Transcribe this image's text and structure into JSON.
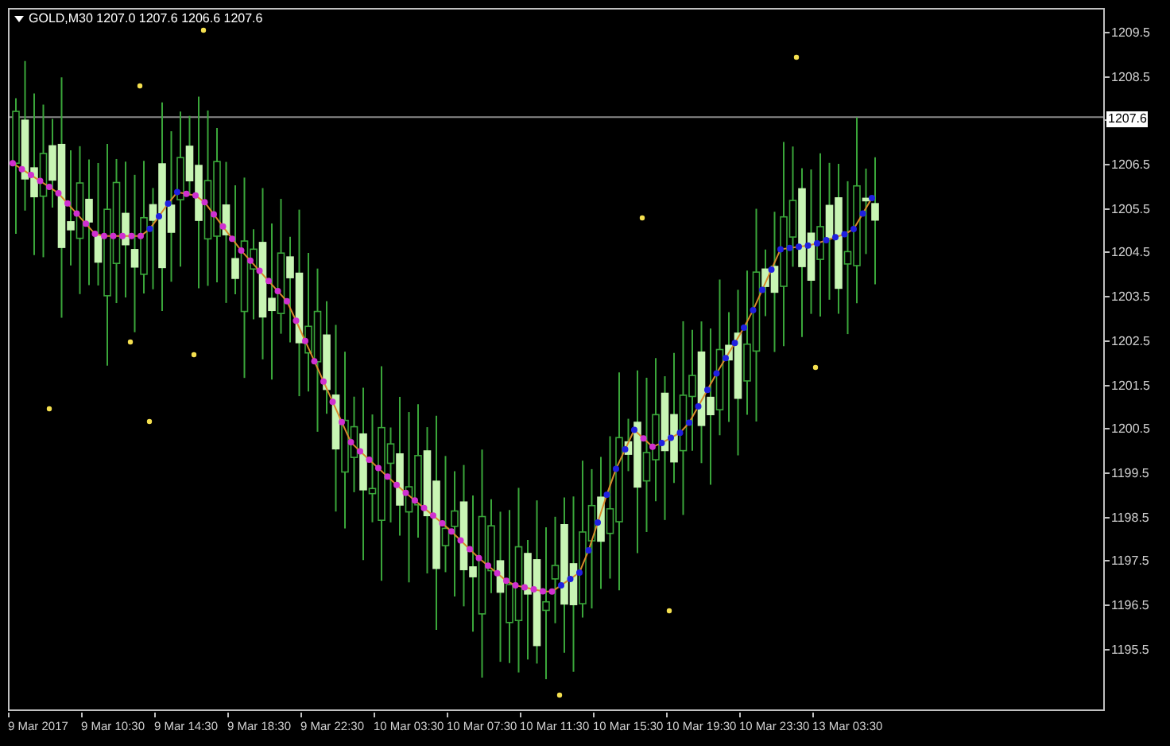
{
  "chart_header": {
    "title": "GOLD,M30 1207.0 1207.6 1206.6 1207.6"
  },
  "price_axis": [
    {
      "kind": "tick",
      "text": "1209.5"
    },
    {
      "kind": "tick",
      "text": "1208.5"
    },
    {
      "kind": "current",
      "text": "1207.6"
    },
    {
      "kind": "tick",
      "text": "1206.5"
    },
    {
      "kind": "tick",
      "text": "1205.5"
    },
    {
      "kind": "tick",
      "text": "1204.5"
    },
    {
      "kind": "tick",
      "text": "1203.5"
    },
    {
      "kind": "tick",
      "text": "1202.5"
    },
    {
      "kind": "tick",
      "text": "1201.5"
    },
    {
      "kind": "tick",
      "text": "1200.5"
    },
    {
      "kind": "tick",
      "text": "1199.5"
    },
    {
      "kind": "tick",
      "text": "1198.5"
    },
    {
      "kind": "tick",
      "text": "1197.5"
    },
    {
      "kind": "tick",
      "text": "1196.5"
    },
    {
      "kind": "tick",
      "text": "1195.5"
    }
  ],
  "time_axis": [
    "9 Mar 2017",
    "9 Mar 10:30",
    "9 Mar 14:30",
    "9 Mar 18:30",
    "9 Mar 22:30",
    "10 Mar 03:30",
    "10 Mar 07:30",
    "10 Mar 11:30",
    "10 Mar 15:30",
    "10 Mar 19:30",
    "10 Mar 23:30",
    "13 Mar 03:30"
  ]
}
